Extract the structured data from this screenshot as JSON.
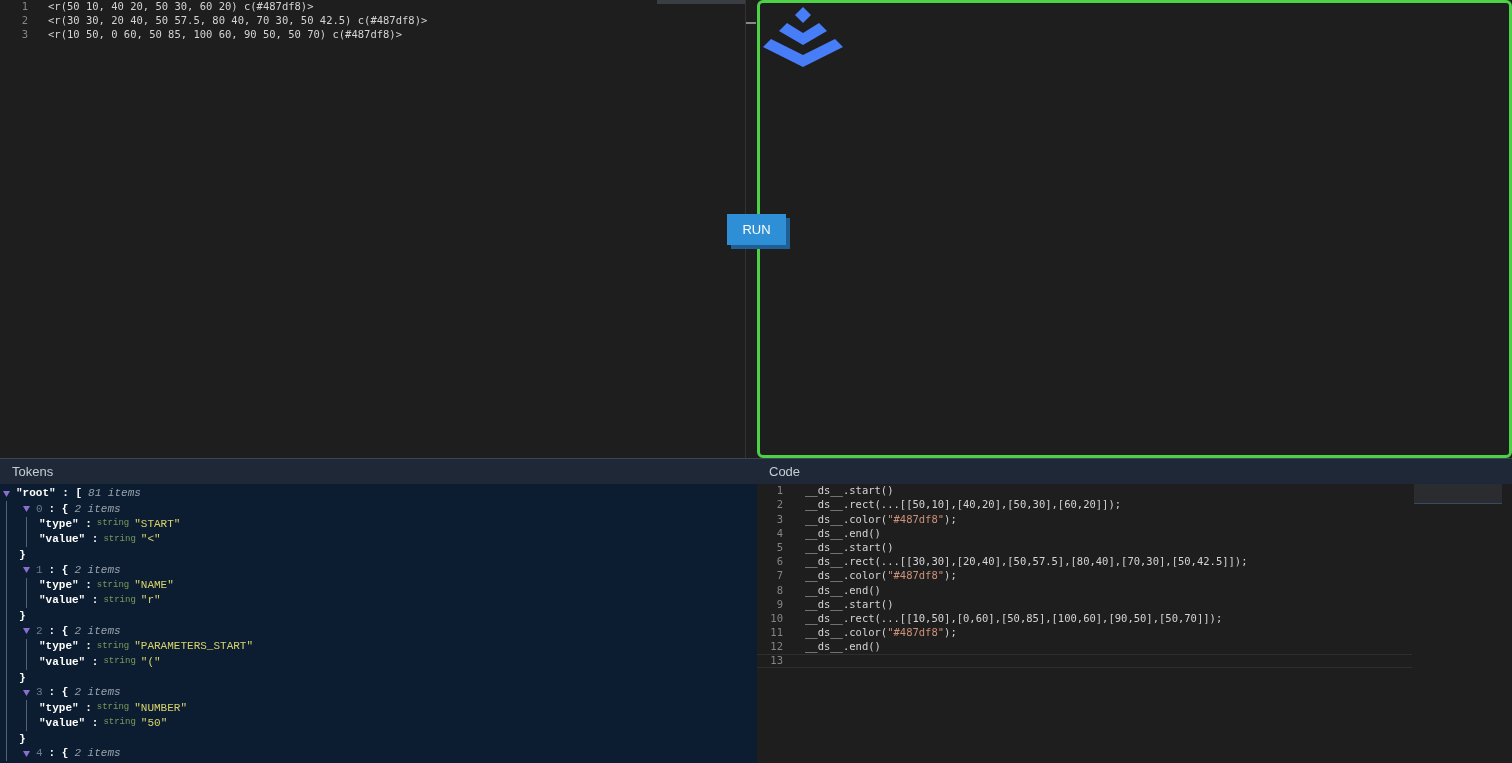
{
  "editor": {
    "lines": [
      {
        "number": "1",
        "text": "<r(50 10, 40 20, 50 30, 60 20) c(#487df8)>"
      },
      {
        "number": "2",
        "text": "<r(30 30, 20 40, 50 57.5, 80 40, 70 30, 50 42.5) c(#487df8)>"
      },
      {
        "number": "3",
        "text": "<r(10 50, 0 60, 50 85, 100 60, 90 50, 50 70) c(#487df8)>"
      }
    ]
  },
  "run_button": {
    "label": "RUN"
  },
  "tokens": {
    "title": "Tokens",
    "root": {
      "key": "\"root\"",
      "bracket": ": [",
      "count": "81 items",
      "expanded": true,
      "children": [
        {
          "index": "0",
          "bracket": ": {",
          "count": "2 items",
          "expanded": true,
          "fields": [
            {
              "key": "\"type\" :",
              "type": "string",
              "value": "\"START\""
            },
            {
              "key": "\"value\" :",
              "type": "string",
              "value": "\"<\""
            }
          ],
          "close": "}"
        },
        {
          "index": "1",
          "bracket": ": {",
          "count": "2 items",
          "expanded": true,
          "fields": [
            {
              "key": "\"type\" :",
              "type": "string",
              "value": "\"NAME\""
            },
            {
              "key": "\"value\" :",
              "type": "string",
              "value": "\"r\""
            }
          ],
          "close": "}"
        },
        {
          "index": "2",
          "bracket": ": {",
          "count": "2 items",
          "expanded": true,
          "fields": [
            {
              "key": "\"type\" :",
              "type": "string",
              "value": "\"PARAMETERS_START\""
            },
            {
              "key": "\"value\" :",
              "type": "string",
              "value": "\"(\""
            }
          ],
          "close": "}"
        },
        {
          "index": "3",
          "bracket": ": {",
          "count": "2 items",
          "expanded": true,
          "fields": [
            {
              "key": "\"type\" :",
              "type": "string",
              "value": "\"NUMBER\""
            },
            {
              "key": "\"value\" :",
              "type": "string",
              "value": "\"50\""
            }
          ],
          "close": "}"
        },
        {
          "index": "4",
          "bracket": ": {",
          "count": "2 items",
          "expanded": true
        }
      ]
    }
  },
  "code": {
    "title": "Code",
    "lines": [
      {
        "number": "1",
        "segments": [
          {
            "kind": "plain",
            "text": "__ds__.start()"
          }
        ]
      },
      {
        "number": "2",
        "segments": [
          {
            "kind": "plain",
            "text": "__ds__.rect(...[[50,10],[40,20],[50,30],[60,20]]);"
          }
        ]
      },
      {
        "number": "3",
        "segments": [
          {
            "kind": "plain",
            "text": "__ds__.color("
          },
          {
            "kind": "string",
            "text": "\"#487df8\""
          },
          {
            "kind": "plain",
            "text": ");"
          }
        ]
      },
      {
        "number": "4",
        "segments": [
          {
            "kind": "plain",
            "text": "__ds__.end()"
          }
        ]
      },
      {
        "number": "5",
        "segments": [
          {
            "kind": "plain",
            "text": "__ds__.start()"
          }
        ]
      },
      {
        "number": "6",
        "segments": [
          {
            "kind": "plain",
            "text": "__ds__.rect(...[[30,30],[20,40],[50,57.5],[80,40],[70,30],[50,42.5]]);"
          }
        ]
      },
      {
        "number": "7",
        "segments": [
          {
            "kind": "plain",
            "text": "__ds__.color("
          },
          {
            "kind": "string",
            "text": "\"#487df8\""
          },
          {
            "kind": "plain",
            "text": ");"
          }
        ]
      },
      {
        "number": "8",
        "segments": [
          {
            "kind": "plain",
            "text": "__ds__.end()"
          }
        ]
      },
      {
        "number": "9",
        "segments": [
          {
            "kind": "plain",
            "text": "__ds__.start()"
          }
        ]
      },
      {
        "number": "10",
        "segments": [
          {
            "kind": "plain",
            "text": "__ds__.rect(...[[10,50],[0,60],[50,85],[100,60],[90,50],[50,70]]);"
          }
        ]
      },
      {
        "number": "11",
        "segments": [
          {
            "kind": "plain",
            "text": "__ds__.color("
          },
          {
            "kind": "string",
            "text": "\"#487df8\""
          },
          {
            "kind": "plain",
            "text": ");"
          }
        ]
      },
      {
        "number": "12",
        "segments": [
          {
            "kind": "plain",
            "text": "__ds__.end()"
          }
        ]
      },
      {
        "number": "13"
      }
    ]
  }
}
